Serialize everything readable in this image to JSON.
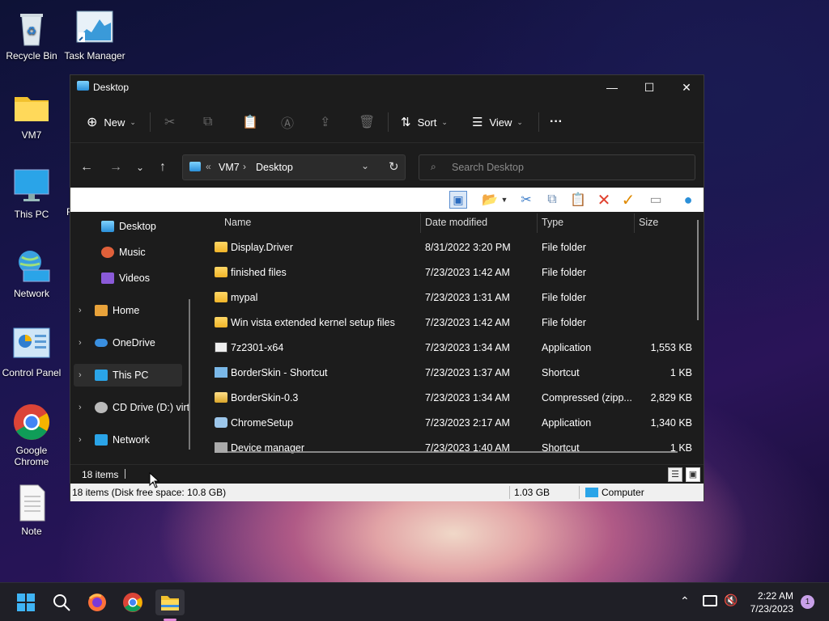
{
  "desktop": {
    "icons": [
      {
        "label": "Recycle Bin"
      },
      {
        "label": "Task Manager"
      },
      {
        "label": "VM7"
      },
      {
        "label": "This PC"
      },
      {
        "label": "Network"
      },
      {
        "label": "Control Panel"
      },
      {
        "label": "Google Chrome"
      },
      {
        "label": "Note"
      }
    ],
    "peek_label": "F"
  },
  "window": {
    "title": "Desktop",
    "controls": {
      "minimize": "—",
      "maximize": "☐",
      "close": "✕"
    },
    "commandbar": {
      "new_label": "New",
      "sort_label": "Sort",
      "view_label": "View",
      "more_label": "···"
    },
    "address": {
      "root_chevron": "«",
      "crumbs": [
        "VM7",
        "Desktop"
      ]
    },
    "search": {
      "placeholder": "Search Desktop"
    },
    "navpane": [
      {
        "label": "Desktop"
      },
      {
        "label": "Music"
      },
      {
        "label": "Videos"
      },
      {
        "label": "Home"
      },
      {
        "label": "OneDrive"
      },
      {
        "label": "This PC"
      },
      {
        "label": "CD Drive (D:) virt"
      },
      {
        "label": "Network"
      }
    ],
    "columns": {
      "name": "Name",
      "date": "Date modified",
      "type": "Type",
      "size": "Size"
    },
    "files": [
      {
        "name": "Display.Driver",
        "date": "8/31/2022 3:20 PM",
        "type": "File folder",
        "size": ""
      },
      {
        "name": "finished files",
        "date": "7/23/2023 1:42 AM",
        "type": "File folder",
        "size": ""
      },
      {
        "name": "mypal",
        "date": "7/23/2023 1:31 AM",
        "type": "File folder",
        "size": ""
      },
      {
        "name": "Win vista extended kernel setup files",
        "date": "7/23/2023 1:42 AM",
        "type": "File folder",
        "size": ""
      },
      {
        "name": "7z2301-x64",
        "date": "7/23/2023 1:34 AM",
        "type": "Application",
        "size": "1,553 KB"
      },
      {
        "name": "BorderSkin - Shortcut",
        "date": "7/23/2023 1:37 AM",
        "type": "Shortcut",
        "size": "1 KB"
      },
      {
        "name": "BorderSkin-0.3",
        "date": "7/23/2023 1:34 AM",
        "type": "Compressed (zipp...",
        "size": "2,829 KB"
      },
      {
        "name": "ChromeSetup",
        "date": "7/23/2023 2:17 AM",
        "type": "Application",
        "size": "1,340 KB"
      },
      {
        "name": "Device manager",
        "date": "7/23/2023 1:40 AM",
        "type": "Shortcut",
        "size": "1 KB"
      }
    ],
    "item_count": "18 items",
    "classic_status": {
      "left": "18 items (Disk free space: 10.8 GB)",
      "size": "1.03 GB",
      "location": "Computer"
    }
  },
  "taskbar": {
    "time": "2:22 AM",
    "date": "7/23/2023",
    "notif_count": "1"
  },
  "colors": {
    "accent": "#0078d4",
    "folder": "#f0b429",
    "close_red": "#e0402e",
    "check_orange": "#e08a00"
  }
}
